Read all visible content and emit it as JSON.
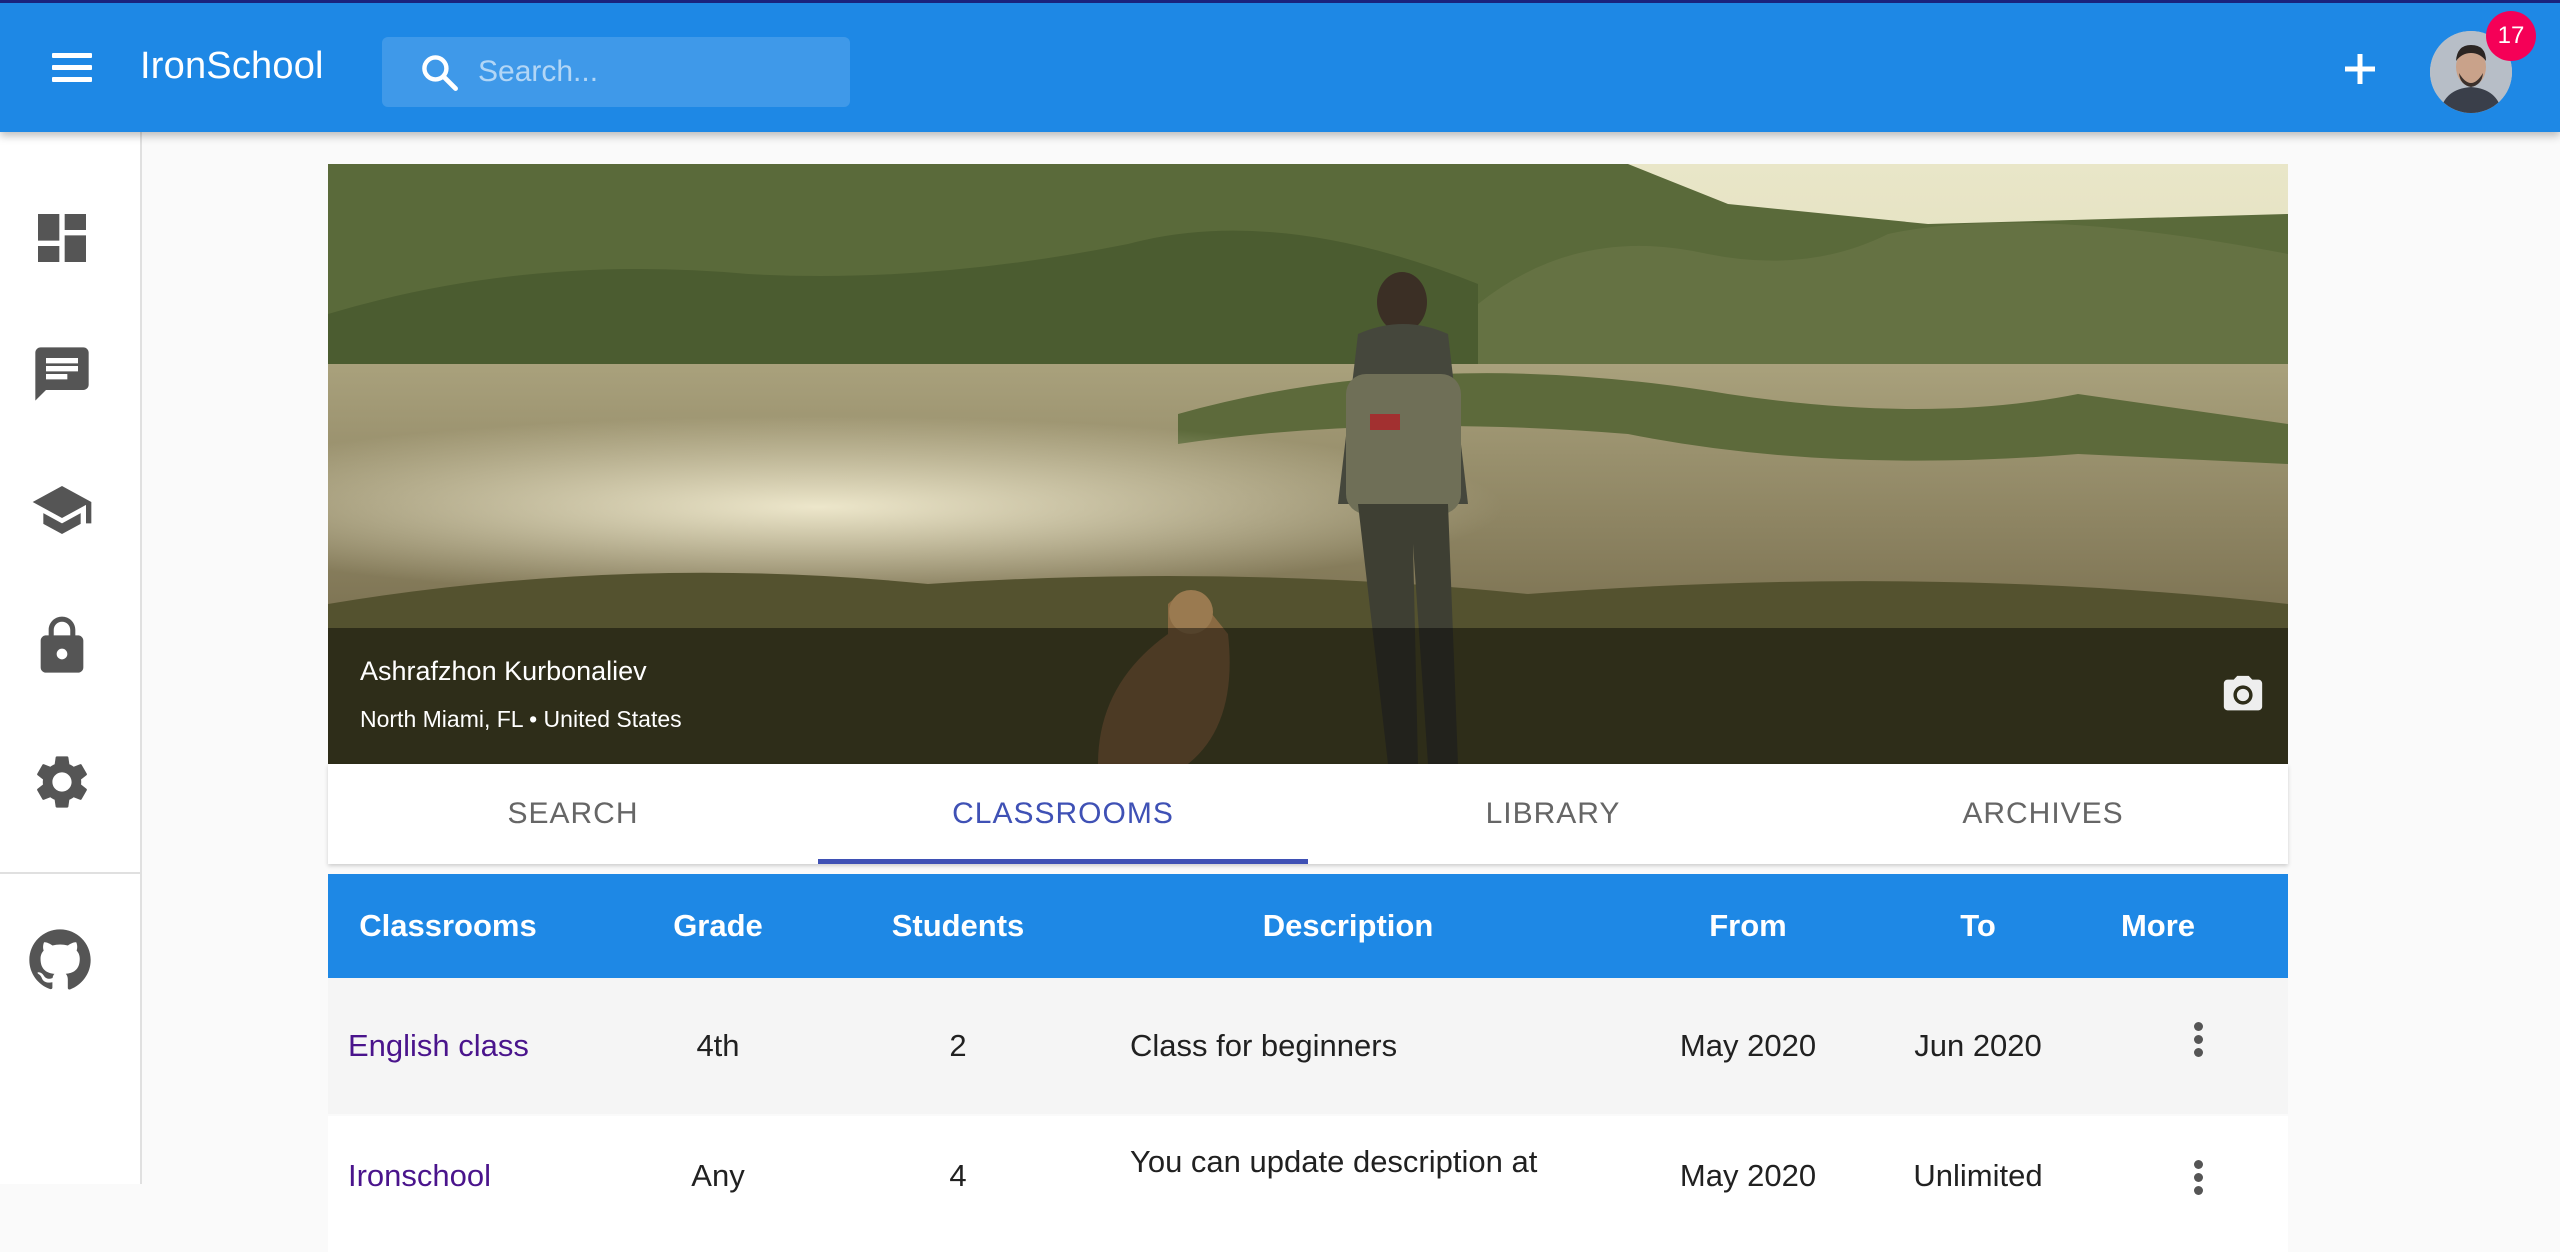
{
  "app": {
    "title": "IronSchool"
  },
  "search": {
    "placeholder": "Search..."
  },
  "notifications": {
    "count": "17"
  },
  "drawer": {
    "items": [
      {
        "icon": "dashboard-icon"
      },
      {
        "icon": "chat-icon"
      },
      {
        "icon": "school-icon"
      },
      {
        "icon": "lock-icon"
      },
      {
        "icon": "gear-icon"
      },
      {
        "icon": "github-icon"
      }
    ]
  },
  "profile": {
    "name": "Ashrafzhon Kurbonaliev",
    "location": "North Miami, FL • United States"
  },
  "tabs": [
    "SEARCH",
    "CLASSROOMS",
    "LIBRARY",
    "ARCHIVES"
  ],
  "active_tab": "CLASSROOMS",
  "table": {
    "headers": [
      "Classrooms",
      "Grade",
      "Students",
      "Description",
      "From",
      "To",
      "More"
    ],
    "rows": [
      {
        "name": "English class",
        "grade": "4th",
        "students": "2",
        "description": "Class for beginners",
        "from": "May 2020",
        "to": "Jun 2020"
      },
      {
        "name": "Ironschool",
        "grade": "Any",
        "students": "4",
        "description": "You can update description at",
        "from": "May 2020",
        "to": "Unlimited"
      }
    ]
  },
  "colors": {
    "primary": "#1e88e5",
    "accent": "#3f51b5",
    "badge": "#f50057",
    "link": "#4a148c"
  }
}
